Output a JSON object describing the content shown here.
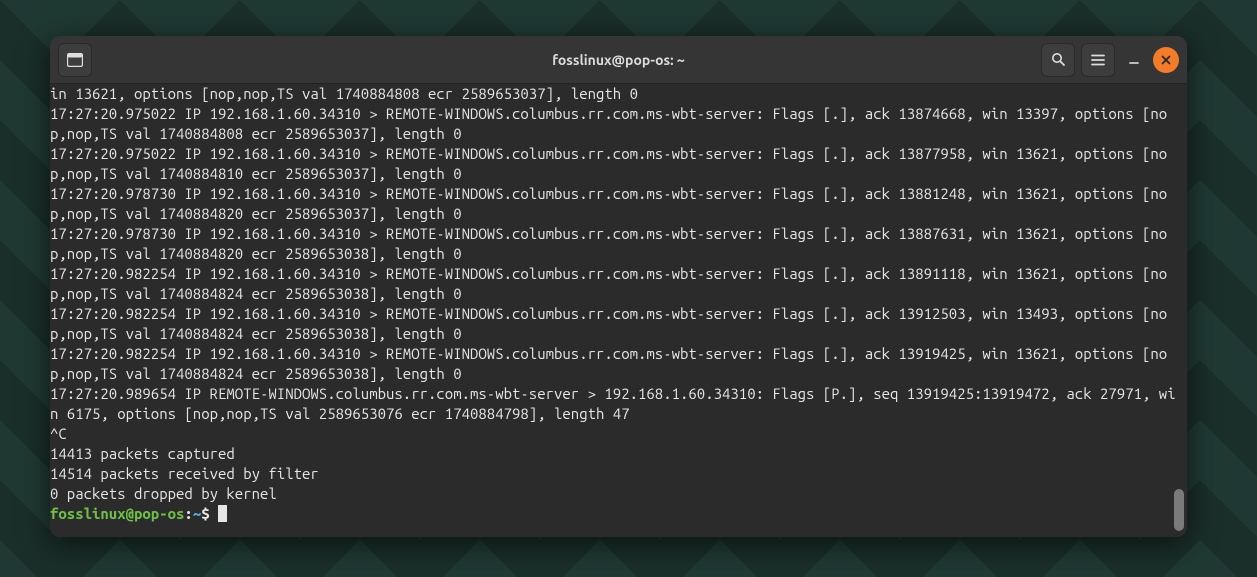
{
  "window": {
    "title": "fosslinux@pop-os: ~"
  },
  "prompt": {
    "user_host": "fosslinux@pop-os",
    "sep": ":",
    "path": "~",
    "dollar": "$ "
  },
  "output": {
    "lines": [
      "in 13621, options [nop,nop,TS val 1740884808 ecr 2589653037], length 0",
      "17:27:20.975022 IP 192.168.1.60.34310 > REMOTE-WINDOWS.columbus.rr.com.ms-wbt-server: Flags [.], ack 13874668, win 13397, options [nop,nop,TS val 1740884808 ecr 2589653037], length 0",
      "17:27:20.975022 IP 192.168.1.60.34310 > REMOTE-WINDOWS.columbus.rr.com.ms-wbt-server: Flags [.], ack 13877958, win 13621, options [nop,nop,TS val 1740884810 ecr 2589653037], length 0",
      "17:27:20.978730 IP 192.168.1.60.34310 > REMOTE-WINDOWS.columbus.rr.com.ms-wbt-server: Flags [.], ack 13881248, win 13621, options [nop,nop,TS val 1740884820 ecr 2589653037], length 0",
      "17:27:20.978730 IP 192.168.1.60.34310 > REMOTE-WINDOWS.columbus.rr.com.ms-wbt-server: Flags [.], ack 13887631, win 13621, options [nop,nop,TS val 1740884820 ecr 2589653038], length 0",
      "17:27:20.982254 IP 192.168.1.60.34310 > REMOTE-WINDOWS.columbus.rr.com.ms-wbt-server: Flags [.], ack 13891118, win 13621, options [nop,nop,TS val 1740884824 ecr 2589653038], length 0",
      "17:27:20.982254 IP 192.168.1.60.34310 > REMOTE-WINDOWS.columbus.rr.com.ms-wbt-server: Flags [.], ack 13912503, win 13493, options [nop,nop,TS val 1740884824 ecr 2589653038], length 0",
      "17:27:20.982254 IP 192.168.1.60.34310 > REMOTE-WINDOWS.columbus.rr.com.ms-wbt-server: Flags [.], ack 13919425, win 13621, options [nop,nop,TS val 1740884824 ecr 2589653038], length 0",
      "17:27:20.989654 IP REMOTE-WINDOWS.columbus.rr.com.ms-wbt-server > 192.168.1.60.34310: Flags [P.], seq 13919425:13919472, ack 27971, win 6175, options [nop,nop,TS val 2589653076 ecr 1740884798], length 47",
      "^C",
      "14413 packets captured",
      "14514 packets received by filter",
      "0 packets dropped by kernel"
    ]
  }
}
